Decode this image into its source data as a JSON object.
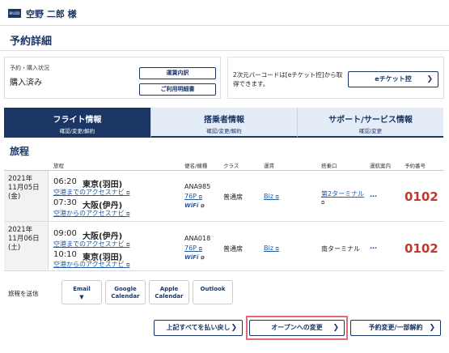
{
  "header": {
    "logo_text": "BIUDD",
    "user_name": "空野 二郎 様",
    "chevron": "❯"
  },
  "page_title": "予約詳細",
  "status": {
    "label": "予約・購入状況",
    "value": "購入済み",
    "fare_button": "運賃内訳",
    "receipt_button": "ご利用明細書"
  },
  "eticket": {
    "text": "2次元バーコードは[eチケット控]から取得できます。",
    "button": "eチケット控"
  },
  "tabs": [
    {
      "label": "フライト情報",
      "sub": "確認/変更/解約"
    },
    {
      "label": "搭乗者情報",
      "sub": "確認/変更/解約"
    },
    {
      "label": "サポート/サービス情報",
      "sub": "確認/変更"
    }
  ],
  "itinerary": {
    "title": "旅程",
    "headers": {
      "route": "旅程",
      "flight": "便名/機種",
      "class": "クラス",
      "fare": "運賃",
      "gate": "搭乗口",
      "status": "運航案内",
      "resno": "予約番号"
    },
    "rows": [
      {
        "date": [
          "2021年",
          "11月05日",
          "(金)"
        ],
        "dep_time": "06:20",
        "dep_city": "東京(羽田)",
        "dep_access": "空港までのアクセスナビ",
        "arr_time": "07:30",
        "arr_city": "大阪(伊丹)",
        "arr_access": "空港からのアクセスナビ",
        "flight_no": "ANA985",
        "aircraft": "76P",
        "wifi": "WiFi",
        "class": "普通席",
        "fare": "Biz",
        "gate": "第2ターミナル",
        "status": "…",
        "resno": "0102"
      },
      {
        "date": [
          "2021年",
          "11月06日",
          "(土)"
        ],
        "dep_time": "09:00",
        "dep_city": "大阪(伊丹)",
        "dep_access": "空港までのアクセスナビ",
        "arr_time": "10:10",
        "arr_city": "東京(羽田)",
        "arr_access": "空港からのアクセスナビ",
        "flight_no": "ANA018",
        "aircraft": "76P",
        "wifi": "WiFi",
        "class": "普通席",
        "fare": "Biz",
        "gate": "南ターミナル",
        "status": "…",
        "resno": "0102"
      }
    ]
  },
  "send": {
    "label": "旅程を送信",
    "buttons": [
      "Email",
      "Google Calendar",
      "Apple Calendar",
      "Outlook"
    ]
  },
  "actions": {
    "reset": "上記すべてを払い戻し",
    "open": "オープンへの変更",
    "change": "予約変更/一部解約"
  },
  "icons": {
    "external": "⧉",
    "chevron": "❯",
    "caret": "▼"
  }
}
